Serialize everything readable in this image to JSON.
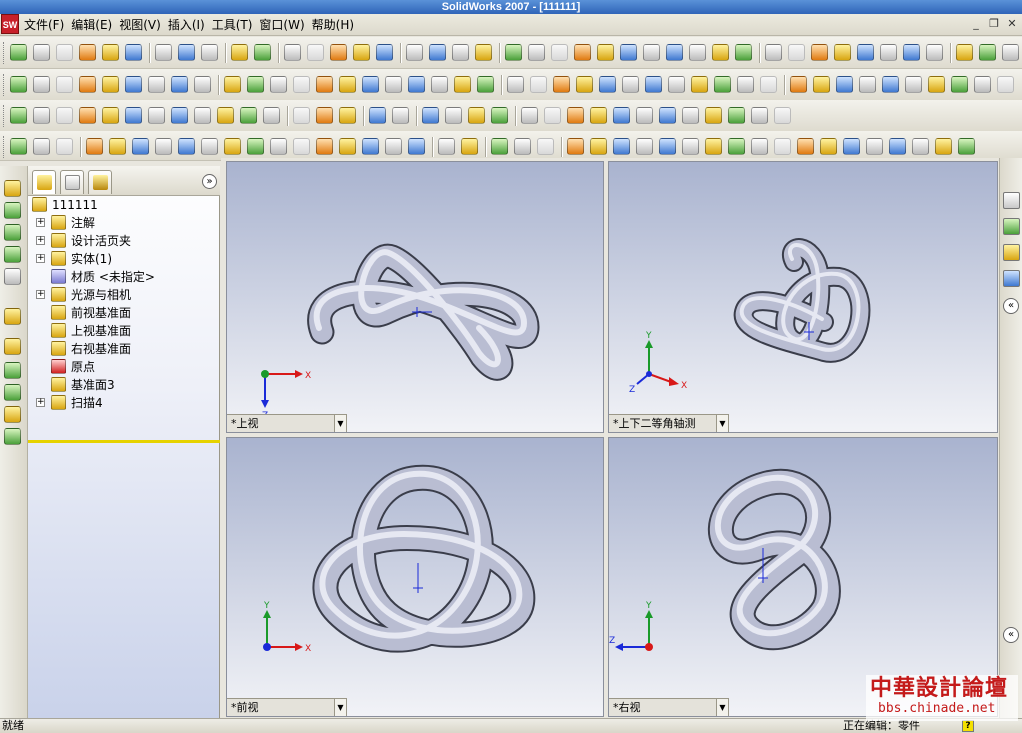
{
  "window": {
    "title": "SolidWorks 2007 - [111111]",
    "logo_text": "SW"
  },
  "menu": [
    "文件(F)",
    "编辑(E)",
    "视图(V)",
    "插入(I)",
    "工具(T)",
    "窗口(W)",
    "帮助(H)"
  ],
  "feature_tree": {
    "root": "111111",
    "items": [
      {
        "label": "注解",
        "expandable": true,
        "icon": "annotation-icon"
      },
      {
        "label": "设计活页夹",
        "expandable": true,
        "icon": "design-binder-icon"
      },
      {
        "label": "实体(1)",
        "expandable": true,
        "icon": "solid-bodies-icon"
      },
      {
        "label": "材质 <未指定>",
        "expandable": false,
        "icon": "material-icon"
      },
      {
        "label": "光源与相机",
        "expandable": true,
        "icon": "lights-cameras-icon"
      },
      {
        "label": "前视基准面",
        "expandable": false,
        "icon": "plane-icon"
      },
      {
        "label": "上视基准面",
        "expandable": false,
        "icon": "plane-icon"
      },
      {
        "label": "右视基准面",
        "expandable": false,
        "icon": "plane-icon"
      },
      {
        "label": "原点",
        "expandable": false,
        "icon": "origin-icon"
      },
      {
        "label": "基准面3",
        "expandable": false,
        "icon": "plane-icon"
      },
      {
        "label": "扫描4",
        "expandable": true,
        "icon": "sweep-icon"
      }
    ]
  },
  "viewports": {
    "top_left": {
      "label": "*上视",
      "axes": [
        "X",
        "Z"
      ]
    },
    "top_right": {
      "label": "*上下二等角轴测",
      "axes": [
        "Y",
        "X",
        "Z"
      ]
    },
    "bottom_left": {
      "label": "*前视",
      "axes": [
        "Y",
        "X"
      ]
    },
    "bottom_right": {
      "label": "*右视",
      "axes": [
        "Y",
        "Z"
      ]
    }
  },
  "collapse_glyph": "»",
  "expand_glyph": "«",
  "status": {
    "left": "就绪",
    "right": "正在编辑：零件",
    "help": "?"
  },
  "watermark": {
    "line1": "中華設計論壇",
    "line2": "bbs.chinade.net"
  },
  "colors": {
    "titlebar": "#2f64b8",
    "viewport_bg_top": "#a9b3cf",
    "viewport_bg_bottom": "#f2f3f7",
    "knot": "#b9bdd2",
    "axis_x": "#d81818",
    "axis_y": "#1a9a2a",
    "axis_z": "#1a2ad8",
    "watermark": "#c41a1a"
  }
}
